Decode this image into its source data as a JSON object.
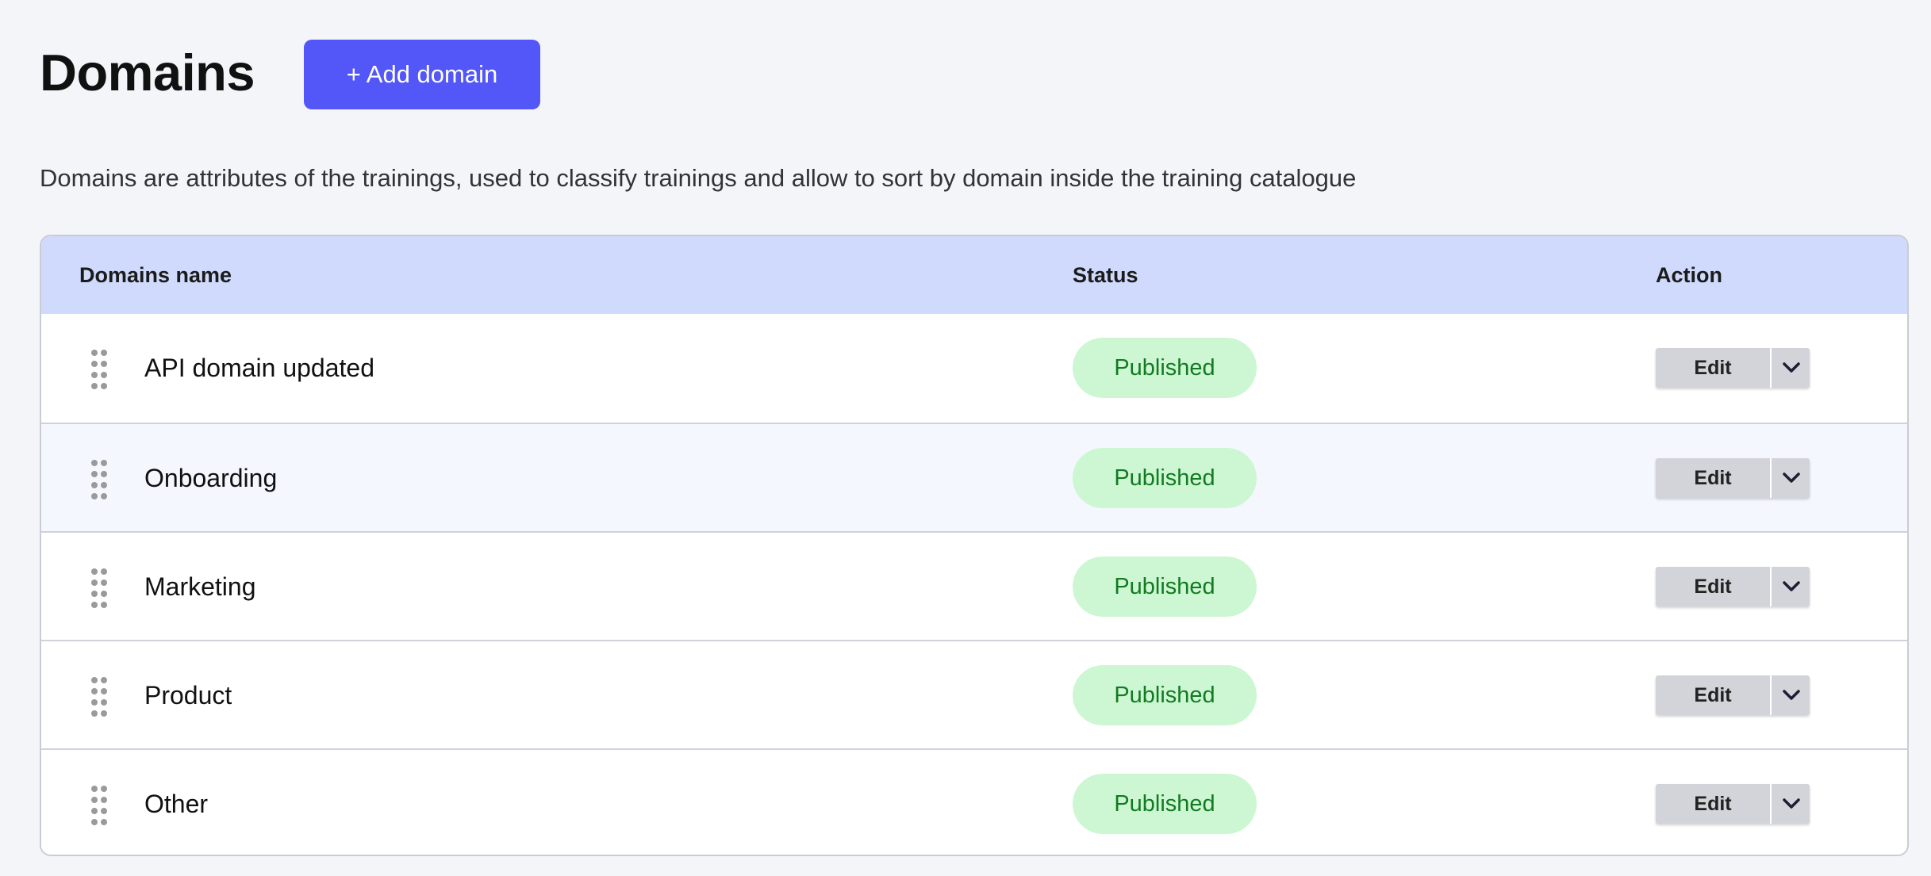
{
  "header": {
    "title": "Domains",
    "add_button_label": "+ Add domain"
  },
  "description": "Domains are attributes of the trainings, used to classify trainings and allow to sort by domain inside the training catalogue",
  "table": {
    "columns": {
      "name": "Domains name",
      "status": "Status",
      "action": "Action"
    },
    "rows": [
      {
        "name": "API domain updated",
        "status": "Published",
        "action_label": "Edit"
      },
      {
        "name": "Onboarding",
        "status": "Published",
        "action_label": "Edit"
      },
      {
        "name": "Marketing",
        "status": "Published",
        "action_label": "Edit"
      },
      {
        "name": "Product",
        "status": "Published",
        "action_label": "Edit"
      },
      {
        "name": "Other",
        "status": "Published",
        "action_label": "Edit"
      }
    ]
  },
  "icons": {
    "drag_handle": "drag-handle-icon",
    "dropdown": "chevron-down-icon"
  },
  "colors": {
    "accent": "#5457f7",
    "header_bg": "#cfdafc",
    "status_bg": "#cdf7d2",
    "status_text": "#137a23"
  }
}
